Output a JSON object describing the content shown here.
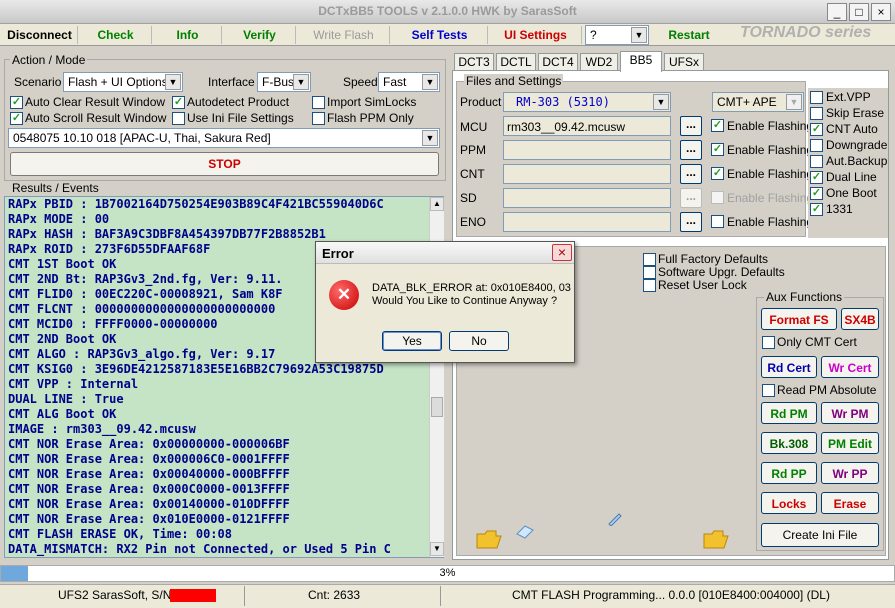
{
  "window": {
    "title": "DCTxBB5 TOOLS v 2.1.0.0 HWK by SarasSoft",
    "min_glyph": "_",
    "max_glyph": "□",
    "close_glyph": "×"
  },
  "toolbar": {
    "disconnect": "Disconnect",
    "check": "Check",
    "info": "Info",
    "verify": "Verify",
    "write_flash": "Write Flash",
    "self_tests": "Self Tests",
    "ui_settings": "UI Settings",
    "help_value": "?",
    "restart": "Restart",
    "brand": "TORNADO series"
  },
  "colors": {
    "check": "#008000",
    "info": "#008000",
    "verify": "#008000",
    "self_tests": "#0000cc",
    "ui_settings": "#cc0000",
    "restart": "#008000",
    "stop": "#cc0000"
  },
  "action_mode": {
    "group_label": "Action / Mode",
    "scenario_label": "Scenario",
    "scenario_value": "Flash + UI Options",
    "interface_label": "Interface",
    "interface_value": "F-Bus",
    "speed_label": "Speed",
    "speed_value": "Fast",
    "auto_clear": "Auto Clear Result Window",
    "autodetect": "Autodetect Product",
    "import_simlocks": "Import SimLocks",
    "auto_scroll": "Auto Scroll Result Window",
    "use_ini": "Use Ini File Settings",
    "flash_ppm": "Flash PPM Only",
    "product_value": "0548075 10.10 018  [APAC-U, Thai, Sakura Red]",
    "stop": "STOP"
  },
  "results": {
    "group_label": "Results / Events",
    "lines": [
      "RAPx PBID : 1B7002164D750254E903B89C4F421BC559040D6C",
      "RAPx MODE : 00",
      "RAPx HASH : BAF3A9C3DBF8A454397DB77F2B8852B1",
      "RAPx ROID : 273F6D55DFAAF68F",
      "CMT 1ST Boot OK",
      "CMT 2ND Bt: RAP3Gv3_2nd.fg, Ver: 9.11.",
      "CMT FLID0 : 00EC220C-00008921, Sam K8F",
      "CMT FLCNT : 0000000000000000000000000",
      "CMT MCID0 : FFFF0000-00000000",
      "CMT 2ND Boot OK",
      "CMT ALGO  : RAP3Gv3_algo.fg, Ver: 9.17",
      "CMT KSIG0 : 3E96DE4212587183E5E16BB2C79692A53C19875D",
      "CMT VPP   : Internal",
      "DUAL LINE : True",
      "CMT ALG Boot OK",
      "IMAGE : rm303__09.42.mcusw",
      "CMT NOR Erase Area: 0x00000000-000006BF",
      "CMT NOR Erase Area: 0x000006C0-0001FFFF",
      "CMT NOR Erase Area: 0x00040000-000BFFFF",
      "CMT NOR Erase Area: 0x000C0000-0013FFFF",
      "CMT NOR Erase Area: 0x00140000-010DFFFF",
      "CMT NOR Erase Area: 0x010E0000-0121FFFF",
      "CMT FLASH ERASE OK, Time: 00:08",
      "DATA_MISMATCH: RX2 Pin not Connected, or Used 5 Pin C"
    ]
  },
  "tabs": [
    "DCT3",
    "DCTL",
    "DCT4",
    "WD2",
    "BB5",
    "UFSx"
  ],
  "files": {
    "group_label": "Files and Settings",
    "product_label": "Product",
    "product_value": "RM-303  (5310)",
    "mode_value": "CMT+ APE",
    "mcu_label": "MCU",
    "mcu_value": "rm303__09.42.mcusw",
    "ppm_label": "PPM",
    "cnt_label": "CNT",
    "sd_label": "SD",
    "eno_label": "ENO",
    "browse": "...",
    "enable_flashing": "Enable Flashing"
  },
  "options": {
    "ext_vpp": "Ext.VPP",
    "skip_erase": "Skip Erase",
    "cnt_auto": "CNT Auto",
    "downgrade": "Downgrade",
    "aut_backup": "Aut.Backup",
    "dual_line": "Dual Line",
    "one_boot": "One Boot",
    "n1331": "1331"
  },
  "defaults": {
    "full_factory": "Full Factory Defaults",
    "software_upgr": "Software Upgr. Defaults",
    "reset_user_lock": "Reset User Lock"
  },
  "aux": {
    "group_label": "Aux Functions",
    "format_fs": "Format FS",
    "sx4b": "SX4B",
    "only_cmt_cert": "Only CMT Cert",
    "rd_cert": "Rd Cert",
    "wr_cert": "Wr Cert",
    "read_pm_absolute": "Read PM Absolute",
    "rd_pm": "Rd PM",
    "wr_pm": "Wr PM",
    "bk308": "Bk.308",
    "pm_edit": "PM Edit",
    "rd_pp": "Rd PP",
    "wr_pp": "Wr PP",
    "locks": "Locks",
    "erase": "Erase",
    "create_ini": "Create Ini File"
  },
  "dialog": {
    "title": "Error",
    "message1": "DATA_BLK_ERROR at: 0x010E8400, 03",
    "message2": "Would You Like to Continue Anyway ?",
    "yes": "Yes",
    "no": "No",
    "close_glyph": "×",
    "error_glyph": "✕"
  },
  "progress": {
    "text": "3%",
    "value": 3
  },
  "status": {
    "left": "UFS2 SarasSoft, S/N",
    "cnt": "Cnt: 2633",
    "right": "CMT FLASH Programming... 0.0.0 [010E8400:004000] (DL)"
  }
}
